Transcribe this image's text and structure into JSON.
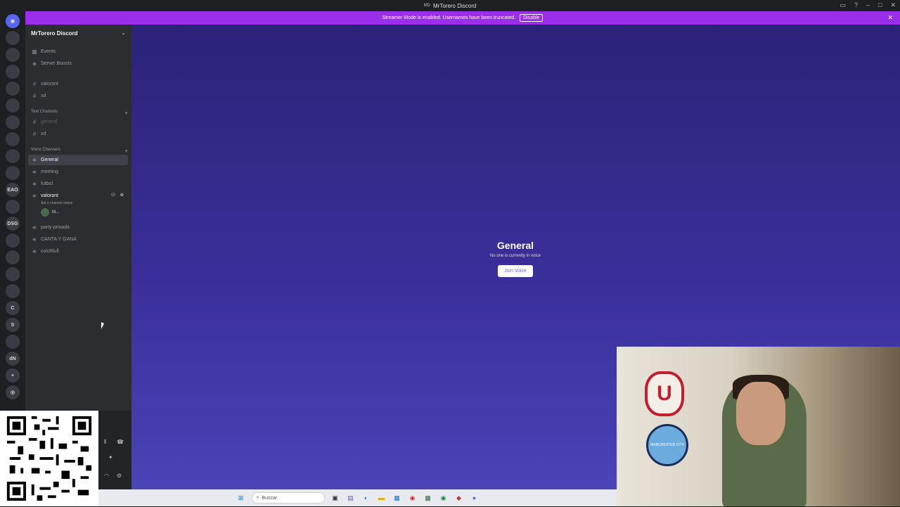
{
  "window": {
    "title": "MrTorero Discord",
    "badge": "MD"
  },
  "banner": {
    "text": "Streamer Mode is enabled. Usernames have been truncated.",
    "button": "Disable"
  },
  "guilds": [
    "",
    "",
    "",
    "",
    "",
    "",
    "",
    "",
    "",
    "EAO",
    "",
    "DSG",
    "",
    "",
    "",
    "C",
    "S",
    "",
    "dN",
    "+",
    ""
  ],
  "server": {
    "name": "MrTorero Discord"
  },
  "nav": {
    "events": "Events",
    "boosts": "Server Boosts"
  },
  "top_channels": [
    "valorant",
    "xd"
  ],
  "text_category": "Text Channels",
  "text_channels": [
    "general",
    "xd"
  ],
  "voice_category": "Voice Channels",
  "voice_channels": [
    "General",
    "meeting",
    "futbol",
    "valorant",
    "party-privada",
    "CANTA Y GANA",
    "colofdull"
  ],
  "valorant_status": "Set a channel status",
  "voice_user": "M...",
  "main": {
    "title": "General",
    "subtitle": "No one is currently in voice",
    "join": "Join Voice"
  },
  "webcam": {
    "badge_text": "MANCHESTER CITY",
    "crest_letter": "U"
  },
  "taskbar": {
    "search": "Buscar"
  }
}
